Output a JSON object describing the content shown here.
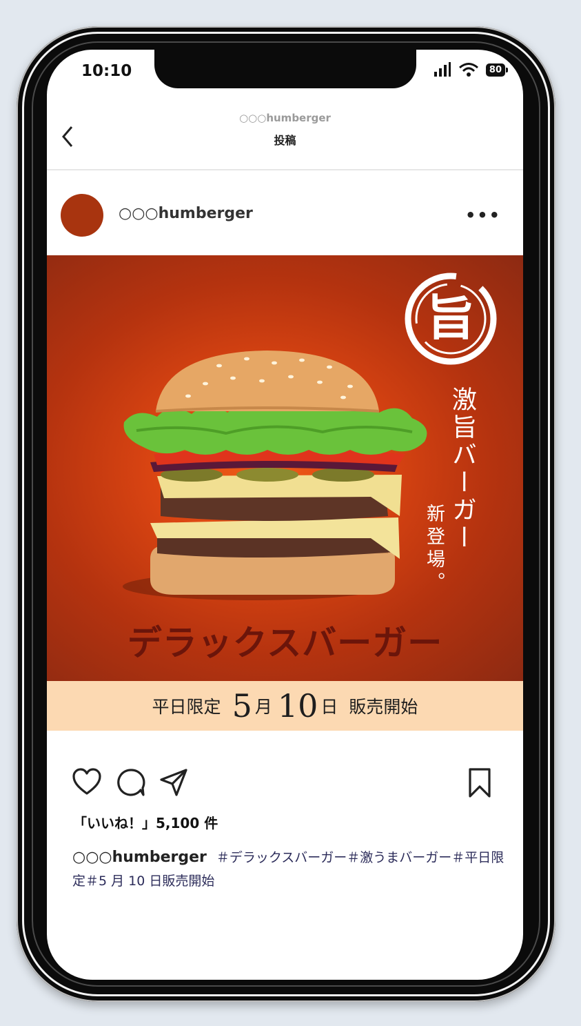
{
  "status_bar": {
    "time": "10:10",
    "battery": "80"
  },
  "header": {
    "account": "○○○humberger",
    "title": "投稿"
  },
  "profile": {
    "username": "○○○humberger",
    "more": "•••"
  },
  "post": {
    "logo_glyph": "旨",
    "vertical_main": "激旨バーガー",
    "vertical_sub": "新登場。",
    "headline": "デラックスバーガー",
    "band": {
      "prefix": "平日限定",
      "month_num": "5",
      "month_unit": "月",
      "day_num": "10",
      "day_unit": "日",
      "suffix": "販売開始"
    }
  },
  "actions": {
    "like": "heart-icon",
    "comment": "comment-icon",
    "share": "send-icon",
    "save": "bookmark-icon"
  },
  "likes_text": "「いいね！」5,100 件",
  "caption": {
    "user": "○○○humberger",
    "tags": "＃デラックスバーガー＃激うまバーガー＃平日限定＃5 月 10 日販売開始"
  }
}
